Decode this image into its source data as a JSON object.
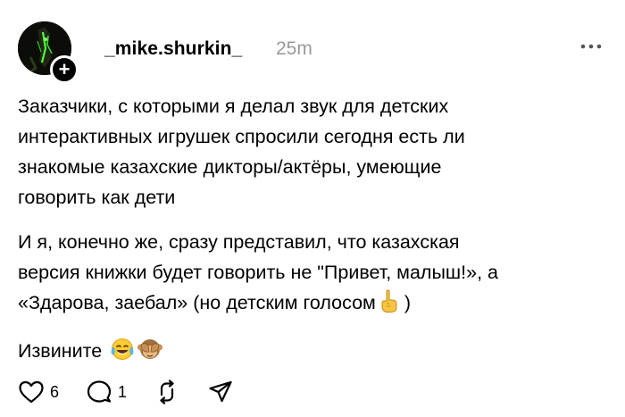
{
  "post": {
    "username": "_mike.shurkin_",
    "time": "25m",
    "follow_symbol": "+",
    "paragraphs": [
      "Заказчики, с которыми я делал звук для детских\nинтерактивных игрушек спросили сегодня есть ли\nзнакомые казахские дикторы/актёры, умеющие\nговорить как дети",
      "И я, конечно же, сразу представил, что казахская\nверсия книжки будет говорить не \"Привет, малыш!», а\n«Здарова, заебал» (но детским голосом"
    ],
    "paragraph2_tail": ")",
    "paragraph3": "Извините",
    "emojis": {
      "pointing_up": "☝️",
      "tears_of_joy": "😂",
      "see_no_evil": "🙈"
    },
    "icons": [
      "more-icon",
      "heart-icon",
      "comment-icon",
      "repost-icon",
      "share-icon"
    ]
  },
  "actions": {
    "likes": "6",
    "comments": "1"
  }
}
